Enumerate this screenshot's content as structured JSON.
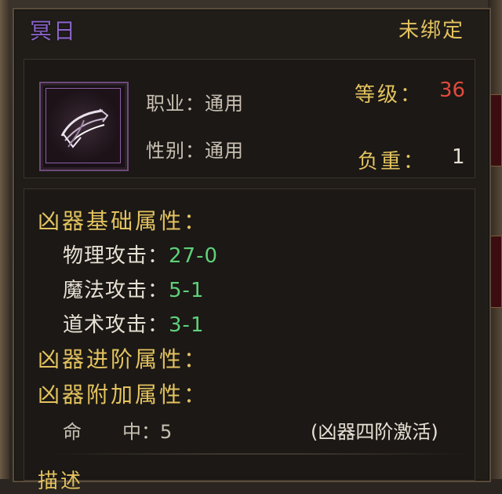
{
  "item": {
    "name": "冥日",
    "bind_status": "未绑定",
    "icon": "whip-weapon-icon"
  },
  "requirements": {
    "class_label": "职业：通用",
    "gender_label": "性别：通用"
  },
  "level": {
    "label": "等级：",
    "value": "36"
  },
  "weight": {
    "label": "负重：",
    "value": "1"
  },
  "sections": {
    "basic_title": "凶器基础属性：",
    "advanced_title": "凶器进阶属性：",
    "extra_title": "凶器附加属性：",
    "desc_title": "描述"
  },
  "basic_stats": [
    {
      "label": "物理攻击：",
      "value": "27-0"
    },
    {
      "label": "魔法攻击：",
      "value": "5-1"
    },
    {
      "label": "道术攻击：",
      "value": "3-1"
    }
  ],
  "extra": {
    "stat_a": "命",
    "stat_b": "中：5",
    "note": "(凶器四阶激活)"
  },
  "colors": {
    "name": "#8a63c8",
    "gold": "#e3c25f",
    "level_value": "#e04a3c",
    "stat_value": "#5fd07a"
  }
}
